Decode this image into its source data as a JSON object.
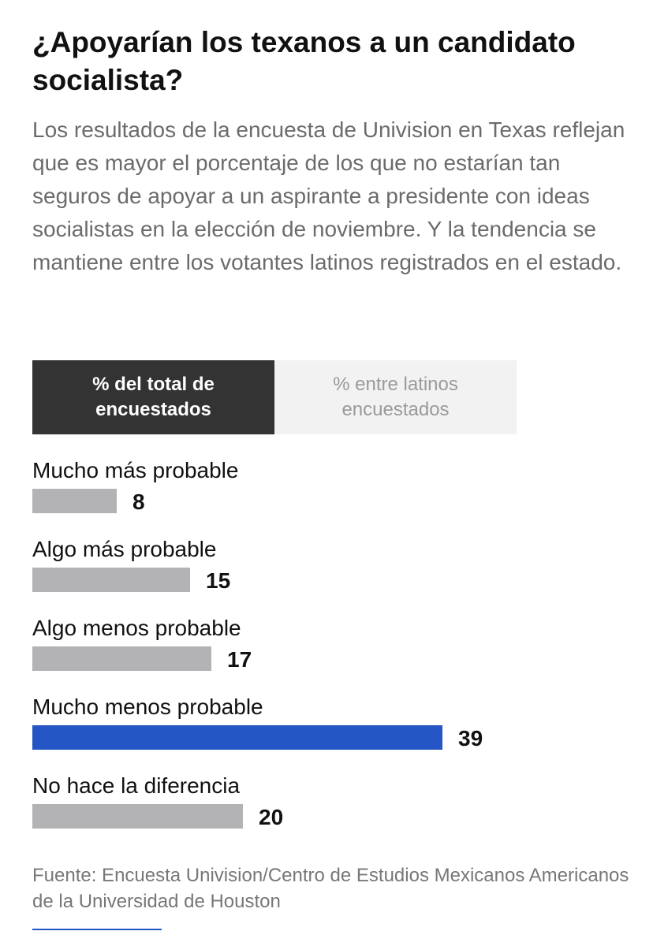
{
  "header": {
    "title": "¿Apoyarían los texanos a un candidato socialista?",
    "subtitle": "Los resultados de la encuesta de Univision en Texas reflejan que es mayor el porcentaje de los que no estarían tan seguros de apoyar a un aspirante a presidente con ideas socialistas en la elección de noviembre. Y la tendencia se mantiene entre los votantes latinos registrados en el estado."
  },
  "tabs": [
    {
      "label": "% del total de encuestados",
      "active": true
    },
    {
      "label": "% entre latinos encuestados",
      "active": false
    }
  ],
  "colors": {
    "bar_default": "#b3b2b4",
    "bar_highlight": "#2456c5",
    "tab_active_bg": "#333333",
    "tab_inactive_bg": "#f2f2f2"
  },
  "chart_data": {
    "type": "bar",
    "orientation": "horizontal",
    "categories": [
      "Mucho más probable",
      "Algo más probable",
      "Algo menos probable",
      "Mucho menos probable",
      "No hace la diferencia"
    ],
    "values": [
      8,
      15,
      17,
      39,
      20
    ],
    "highlight_index": 3,
    "xlim": [
      0,
      39
    ],
    "grid": false
  },
  "footer": {
    "source": "Fuente: Encuesta Univision/Centro de Estudios Mexicanos Americanos de la Universidad de Houston"
  }
}
